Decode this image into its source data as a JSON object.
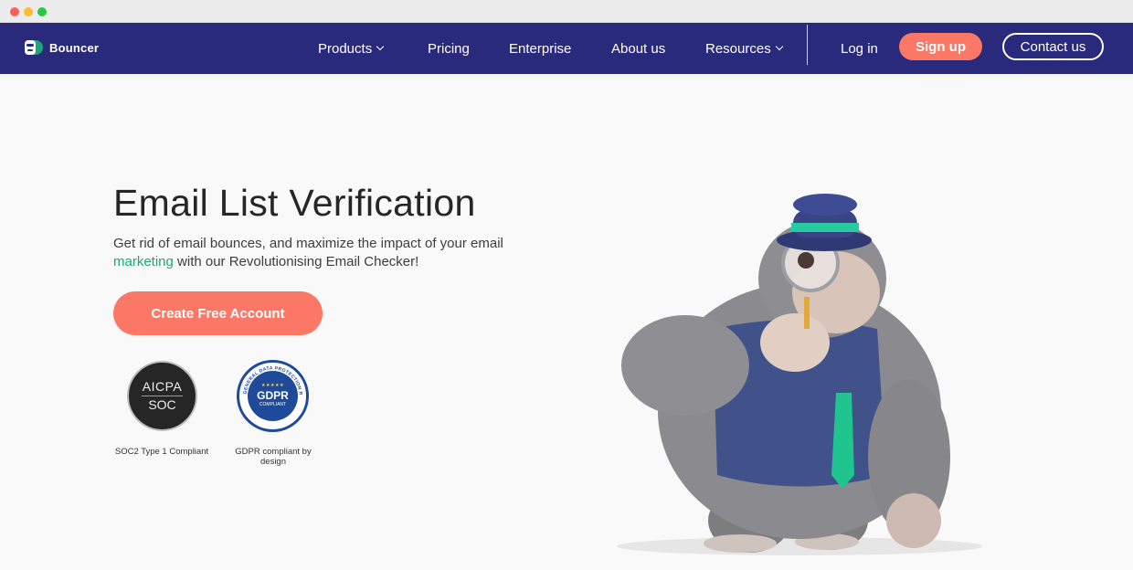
{
  "nav": {
    "brand": "Bouncer",
    "items": [
      {
        "label": "Products",
        "dropdown": true
      },
      {
        "label": "Pricing",
        "dropdown": false
      },
      {
        "label": "Enterprise",
        "dropdown": false
      },
      {
        "label": "About us",
        "dropdown": false
      },
      {
        "label": "Resources",
        "dropdown": true
      }
    ],
    "login": "Log in",
    "signup": "Sign up",
    "contact": "Contact us"
  },
  "hero": {
    "title": "Email List Verification",
    "subtitle_part1": "Get rid of email bounces, and maximize the impact of your email ",
    "subtitle_accent": "marketing",
    "subtitle_part2": " with our Revolutionising Email Checker!",
    "cta": "Create Free Account"
  },
  "badges": {
    "aicpa": {
      "line1": "AICPA",
      "line2": "SOC",
      "caption": "SOC2 Type 1 Compliant"
    },
    "gdpr": {
      "title": "GDPR",
      "sub": "COMPLIANT",
      "ring_text": "GENERAL DATA PROTECTION REGULATION",
      "caption": "GDPR compliant by design"
    }
  },
  "colors": {
    "nav_bg": "#2a2a7c",
    "accent_coral": "#fb7867",
    "accent_green": "#1ea67b",
    "gdpr_blue": "#1f4a9a"
  },
  "icons": [
    "bouncer-logo-icon",
    "chevron-down-icon",
    "gorilla-mascot-illustration"
  ]
}
